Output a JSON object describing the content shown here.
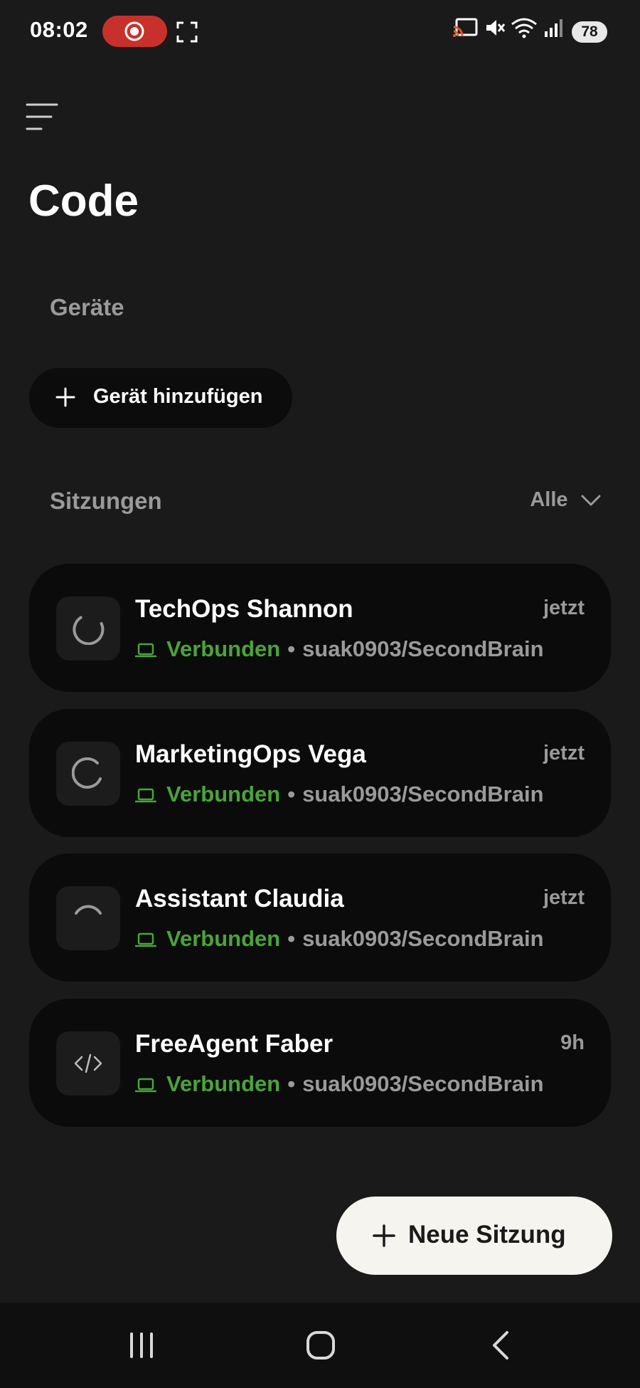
{
  "status_bar": {
    "time": "08:02",
    "battery": "78",
    "icons": [
      "screen-record-icon",
      "screenshot-icon",
      "cast-icon",
      "mute-icon",
      "wifi-icon",
      "signal-icon",
      "battery-icon"
    ]
  },
  "header": {
    "menu_icon": "hamburger-menu-icon",
    "title": "Code"
  },
  "devices": {
    "section_label": "Geräte",
    "add_button_label": "Gerät hinzufügen"
  },
  "sessions": {
    "section_label": "Sitzungen",
    "filter_label": "Alle",
    "items": [
      {
        "name": "TechOps Shannon",
        "time": "jetzt",
        "status": "Verbunden",
        "separator": "•",
        "repo": "suak0903/SecondBrain",
        "icon": "loading-spinner-icon"
      },
      {
        "name": "MarketingOps Vega",
        "time": "jetzt",
        "status": "Verbunden",
        "separator": "•",
        "repo": "suak0903/SecondBrain",
        "icon": "loading-spinner-icon"
      },
      {
        "name": "Assistant Claudia",
        "time": "jetzt",
        "status": "Verbunden",
        "separator": "•",
        "repo": "suak0903/SecondBrain",
        "icon": "loading-spinner-icon"
      },
      {
        "name": "FreeAgent Faber",
        "time": "9h",
        "status": "Verbunden",
        "separator": "•",
        "repo": "suak0903/SecondBrain",
        "icon": "code-icon"
      }
    ]
  },
  "fab": {
    "label": "Neue Sitzung"
  },
  "nav_bar": {
    "icons": [
      "recent-apps-icon",
      "home-icon",
      "back-icon"
    ]
  },
  "colors": {
    "background": "#1a1a1a",
    "card": "#0b0b0b",
    "status_green": "#4aa43a",
    "muted_text": "#9a9a9a",
    "record_red": "#c8312b",
    "fab_background": "#f5f4ef"
  }
}
